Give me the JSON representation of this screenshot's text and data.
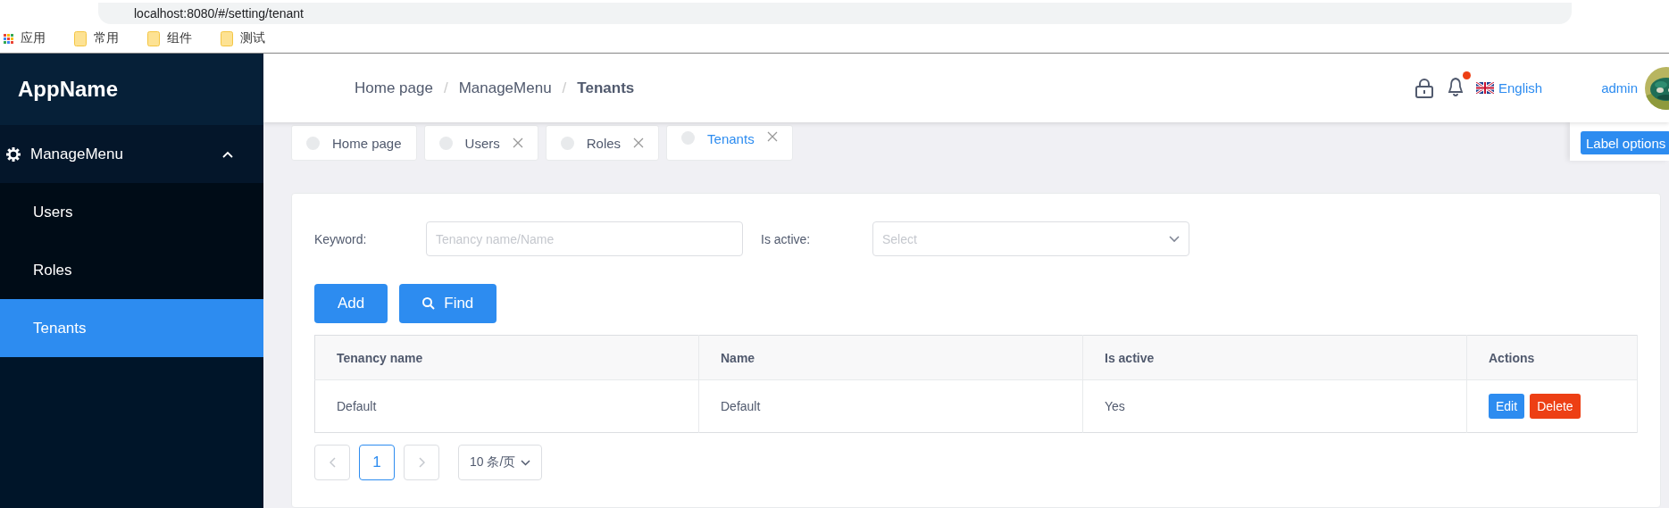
{
  "browser": {
    "address": "localhost:8080/#/setting/tenant",
    "bookmarks": [
      {
        "label": "应用",
        "kind": "apps"
      },
      {
        "label": "常用",
        "kind": "folder"
      },
      {
        "label": "组件",
        "kind": "folder"
      },
      {
        "label": "测试",
        "kind": "folder"
      }
    ]
  },
  "sidebar": {
    "app_name": "AppName",
    "menu": [
      {
        "label": "ManageMenu",
        "expanded": true,
        "children": [
          {
            "label": "Users",
            "selected": false
          },
          {
            "label": "Roles",
            "selected": false
          },
          {
            "label": "Tenants",
            "selected": true
          }
        ]
      }
    ]
  },
  "header": {
    "breadcrumb": [
      {
        "label": "Home page",
        "current": false
      },
      {
        "label": "ManageMenu",
        "current": false
      },
      {
        "label": "Tenants",
        "current": true
      }
    ],
    "breadcrumb_separator": "/",
    "has_notification": true,
    "language": "English",
    "user": "admin"
  },
  "tabs": [
    {
      "label": "Home page",
      "selected": false,
      "closable": false
    },
    {
      "label": "Users",
      "selected": false,
      "closable": true
    },
    {
      "label": "Roles",
      "selected": false,
      "closable": true
    },
    {
      "label": "Tenants",
      "selected": true,
      "closable": true
    }
  ],
  "label_options": "Label options",
  "filters": [
    {
      "kind": "text",
      "label": "Keyword:",
      "placeholder": "Tenancy name/Name"
    },
    {
      "kind": "select",
      "label": "Is active:",
      "placeholder": "Select"
    }
  ],
  "buttons": [
    {
      "kind": "add",
      "label": "Add"
    },
    {
      "kind": "find",
      "label": "Find"
    }
  ],
  "table": {
    "columns": [
      "Tenancy name",
      "Name",
      "Is active",
      "Actions"
    ],
    "rows": [
      {
        "cells": [
          "Default",
          "Default",
          "Yes"
        ],
        "actions": [
          {
            "kind": "edit",
            "label": "Edit"
          },
          {
            "kind": "delete",
            "label": "Delete"
          }
        ]
      }
    ]
  },
  "pagination": {
    "pages": [
      {
        "label": "1",
        "selected": true
      }
    ],
    "page_size": "10 条/页"
  }
}
